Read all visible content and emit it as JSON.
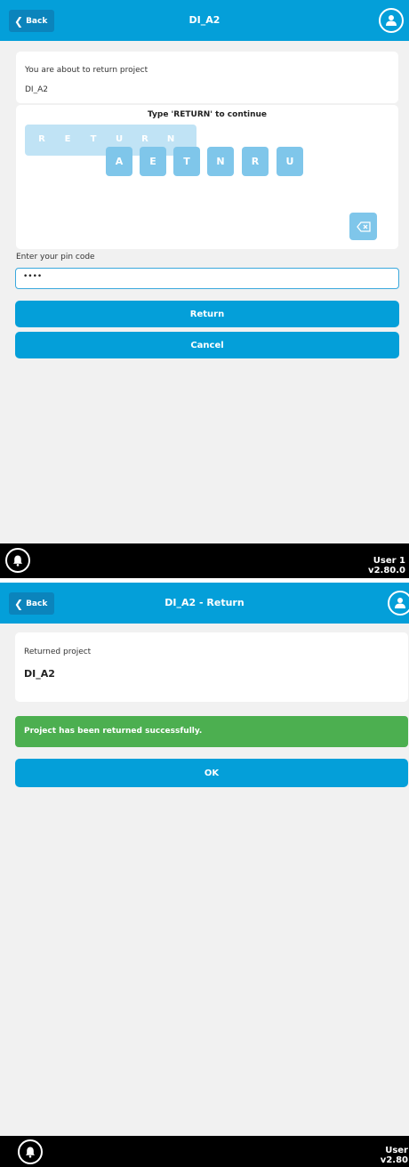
{
  "screen1": {
    "header": {
      "back_label": "Back",
      "title": "DI_A2"
    },
    "info": {
      "line1": "You are about to return project",
      "project": "DI_A2"
    },
    "confirm": {
      "instruction": "Type 'RETURN' to continue",
      "slots": [
        "R",
        "E",
        "T",
        "U",
        "R",
        "N"
      ],
      "keys": [
        "A",
        "E",
        "T",
        "N",
        "R",
        "U"
      ],
      "backspace_icon": "backspace-icon"
    },
    "pin": {
      "label": "Enter your pin code",
      "value": "••••"
    },
    "buttons": {
      "return_label": "Return",
      "cancel_label": "Cancel"
    },
    "footer": {
      "user": "User 1",
      "version": "v2.80.0"
    }
  },
  "screen2": {
    "header": {
      "back_label": "Back",
      "title": "DI_A2 - Return"
    },
    "info": {
      "line1": "Returned project",
      "project": "DI_A2"
    },
    "success_message": "Project has been returned successfully.",
    "ok_label": "OK",
    "footer": {
      "user": "User",
      "version": "v2.80"
    }
  },
  "colors": {
    "primary": "#049fd9",
    "back_button": "#0b84bc",
    "success": "#4caf50",
    "key_tile": "#7fc6ea"
  }
}
